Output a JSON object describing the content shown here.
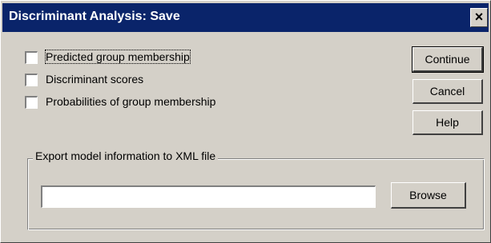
{
  "window": {
    "title": "Discriminant Analysis: Save",
    "close_glyph": "×"
  },
  "options": [
    {
      "label": "Predicted group membership",
      "checked": false
    },
    {
      "label": "Discriminant scores",
      "checked": false
    },
    {
      "label": "Probabilities of group membership",
      "checked": false
    }
  ],
  "buttons": {
    "continue": "Continue",
    "cancel": "Cancel",
    "help": "Help",
    "browse": "Browse"
  },
  "export": {
    "group_label": "Export model information to XML file",
    "file_path": ""
  }
}
